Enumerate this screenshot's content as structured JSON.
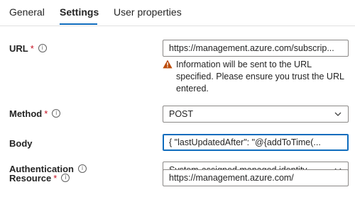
{
  "tabs": [
    {
      "label": "General"
    },
    {
      "label": "Settings"
    },
    {
      "label": "User properties"
    }
  ],
  "url": {
    "label": "URL",
    "value": "https://management.azure.com/subscrip...",
    "warning_line1": "Information will be sent to the URL",
    "warning_line2": "specified. Please ensure you trust the URL",
    "warning_line3": "entered."
  },
  "method": {
    "label": "Method",
    "value": "POST"
  },
  "body": {
    "label": "Body",
    "value": "{ \"lastUpdatedAfter\": \"@{addToTime(..."
  },
  "authentication": {
    "label": "Authentication",
    "value": "System-assigned managed identity"
  },
  "resource": {
    "label": "Resource",
    "value": "https://management.azure.com/"
  },
  "required_mark": "*",
  "info_glyph": "i",
  "colors": {
    "accent": "#0f6cbd",
    "required": "#c50f1f",
    "warning": "#bc4b09"
  }
}
